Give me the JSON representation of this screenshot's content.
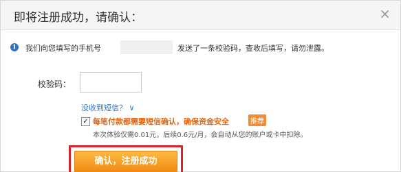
{
  "dialog": {
    "title": "即将注册成功，请确认：",
    "close_glyph": "×"
  },
  "notice": {
    "info_glyph": "i",
    "text_before_phone": "我们向您填写的手机号",
    "text_after_phone": "发送了一条校验码，查收后填写，请勿泄露。"
  },
  "form": {
    "code_label": "校验码：",
    "code_value": "",
    "code_placeholder": "",
    "no_sms_link": "没收到短信？ ∨"
  },
  "option": {
    "checked": true,
    "check_glyph": "✓",
    "main_text": "每笔付款都需要短信确认，确保资金安全",
    "tag": "推荐",
    "sub_text": "本次体验仅需0.01元，后续0.6元/月，会自动从您的账户或卡中扣除。"
  },
  "actions": {
    "confirm_label": "确认，注册成功"
  },
  "colors": {
    "accent_orange": "#f18a12",
    "highlight_red": "#d9252a",
    "link_blue": "#2a75c9"
  },
  "icons": [
    "info-icon",
    "close-icon",
    "checkbox-check-icon"
  ]
}
